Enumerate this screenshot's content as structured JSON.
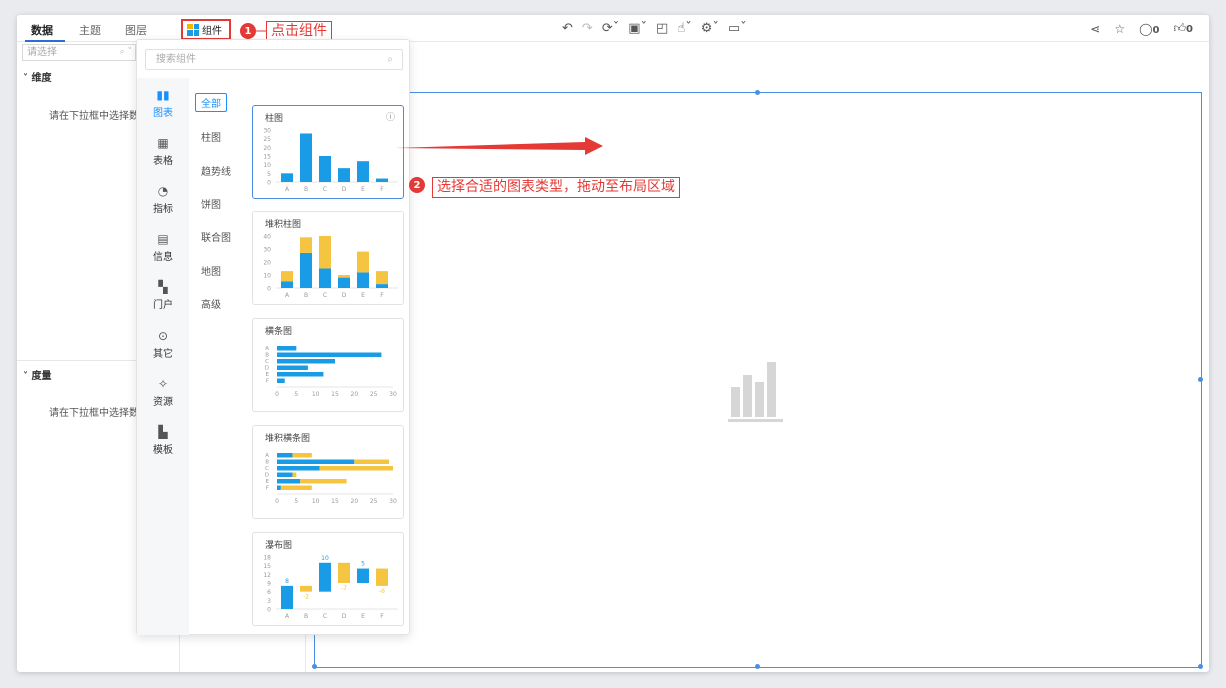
{
  "tabs": [
    {
      "label": "数据",
      "active": true
    },
    {
      "label": "主题",
      "active": false
    },
    {
      "label": "图层",
      "active": false
    }
  ],
  "component_button": {
    "label": "组件",
    "icon": "grid-icon"
  },
  "annotations": [
    {
      "number": "1",
      "text": "点击组件"
    },
    {
      "number": "2",
      "text": "选择合适的图表类型，拖动至布局区域"
    }
  ],
  "toolbar": {
    "icons": [
      "undo-icon",
      "redo-icon",
      "refresh-icon",
      "save-icon",
      "preview-icon",
      "hand-icon",
      "settings-icon",
      "monitor-icon"
    ],
    "right": {
      "comment_count": "0",
      "like_count": "0"
    }
  },
  "left_panel": {
    "select_placeholder": "请选择",
    "dimension_title": "维度",
    "dimension_hint": "请在下拉框中选择数",
    "measure_title": "度量",
    "measure_hint": "请在下拉框中选择数"
  },
  "dropdown": {
    "search_placeholder": "搜索组件",
    "categories": [
      {
        "label": "图表",
        "icon": "bar-chart-icon",
        "active": true
      },
      {
        "label": "表格",
        "icon": "table-icon",
        "active": false
      },
      {
        "label": "指标",
        "icon": "gauge-icon",
        "active": false
      },
      {
        "label": "信息",
        "icon": "info-card-icon",
        "active": false
      },
      {
        "label": "门户",
        "icon": "portal-icon",
        "active": false
      },
      {
        "label": "其它",
        "icon": "more-icon",
        "active": false
      },
      {
        "label": "资源",
        "icon": "puzzle-icon",
        "active": false
      },
      {
        "label": "模板",
        "icon": "template-icon",
        "active": false
      }
    ],
    "subcategories": [
      "全部",
      "柱图",
      "趋势线",
      "饼图",
      "联合图",
      "地图",
      "高级"
    ],
    "cards": [
      {
        "title": "柱图",
        "type": "bar",
        "categories": [
          "A",
          "B",
          "C",
          "D",
          "E",
          "F"
        ],
        "values": [
          5,
          28,
          15,
          8,
          12,
          2
        ],
        "yticks": [
          "30",
          "25",
          "20",
          "15",
          "10",
          "5",
          "0"
        ],
        "ymax": 30,
        "info_icon": "info-icon"
      },
      {
        "title": "堆积柱图",
        "type": "stacked-bar",
        "categories": [
          "A",
          "B",
          "C",
          "D",
          "E",
          "F"
        ],
        "series": [
          {
            "color": "#1a9be6",
            "values": [
              5,
              27,
              15,
              8,
              12,
              3
            ]
          },
          {
            "color": "#f5c542",
            "values": [
              8,
              12,
              25,
              2,
              16,
              10
            ]
          }
        ],
        "yticks": [
          "40",
          "30",
          "20",
          "10",
          "0"
        ],
        "ymax": 40
      },
      {
        "title": "横条图",
        "type": "hbar",
        "categories": [
          "A",
          "B",
          "C",
          "D",
          "E",
          "F"
        ],
        "values": [
          5,
          27,
          15,
          8,
          12,
          2
        ],
        "xticks": [
          "0",
          "5",
          "10",
          "15",
          "20",
          "25",
          "30"
        ],
        "xmax": 30
      },
      {
        "title": "堆积横条图",
        "type": "stacked-hbar",
        "categories": [
          "A",
          "B",
          "C",
          "D",
          "E",
          "F"
        ],
        "series": [
          {
            "color": "#1a9be6",
            "values": [
              4,
              20,
              11,
              4,
              6,
              1
            ]
          },
          {
            "color": "#f5c542",
            "values": [
              5,
              9,
              19,
              1,
              12,
              8
            ]
          }
        ],
        "xticks": [
          "0",
          "5",
          "10",
          "15",
          "20",
          "25",
          "30"
        ],
        "xmax": 30
      },
      {
        "title": "瀑布图",
        "type": "waterfall",
        "categories": [
          "A",
          "B",
          "C",
          "D",
          "E",
          "F"
        ],
        "deltas": [
          8,
          -2,
          10,
          -7,
          5,
          -6
        ],
        "labels": [
          "8",
          "-2",
          "10",
          "-7",
          "5",
          "-6"
        ],
        "yticks": [
          "18",
          "15",
          "12",
          "9",
          "6",
          "3",
          "0"
        ],
        "ymax": 18
      }
    ]
  },
  "colors": {
    "primary": "#1a9be6",
    "secondary": "#f5c542",
    "accent": "#e53935",
    "selection": "#4a90e2"
  }
}
